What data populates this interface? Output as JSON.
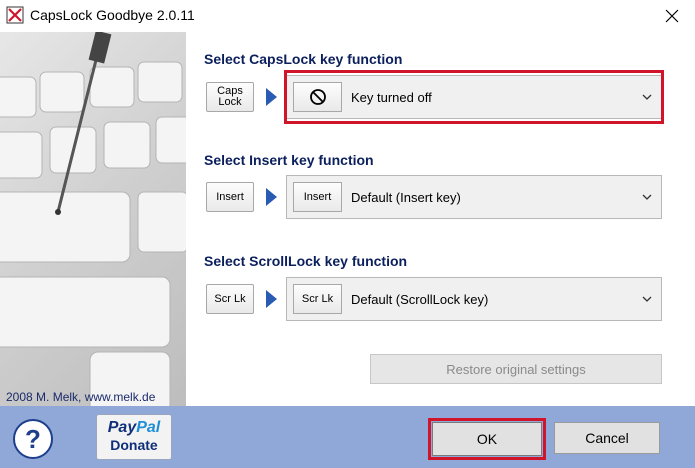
{
  "window": {
    "title": "CapsLock Goodbye 2.0.11",
    "close_icon": "close-icon",
    "app_icon": "capslock-app-icon"
  },
  "side_panel": {
    "image": "keyboard-with-screwdriver-image",
    "copyright": "2008 M. Melk, www.melk.de"
  },
  "sections": {
    "capslock": {
      "title": "Select CapsLock key function",
      "key_label": "Caps\nLock",
      "selected_icon": "no-entry-icon",
      "selected_value": "Key turned off",
      "highlighted": true
    },
    "insert": {
      "title": "Select Insert key function",
      "key_label": "Insert",
      "selected_key": "Insert",
      "selected_value": "Default (Insert key)"
    },
    "scrolllock": {
      "title": "Select ScrollLock key function",
      "key_label": "Scr Lk",
      "selected_key": "Scr Lk",
      "selected_value": "Default (ScrollLock key)"
    }
  },
  "restore_button": {
    "label": "Restore original settings",
    "disabled": true
  },
  "footer": {
    "help_label": "?",
    "paypal": {
      "brand_pay": "Pay",
      "brand_pal": "Pal",
      "action": "Donate"
    },
    "ok_label": "OK",
    "cancel_label": "Cancel"
  },
  "colors": {
    "section_title": "#0b1f5c",
    "highlight_border": "#d0142a",
    "footer_bg": "#8fa8d8",
    "arrow": "#2a5bb3"
  }
}
